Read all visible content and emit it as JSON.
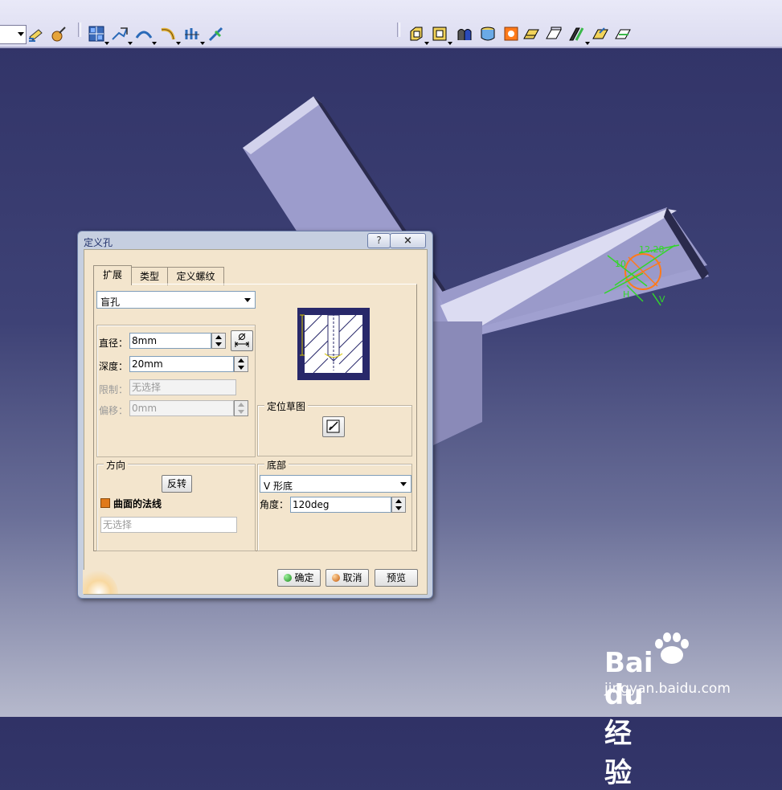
{
  "dialog": {
    "title": "定义孔",
    "help_label": "?",
    "close_label": "×",
    "tabs": [
      {
        "label": "扩展"
      },
      {
        "label": "类型"
      },
      {
        "label": "定义螺纹"
      }
    ],
    "extension_type": "盲孔",
    "diameter": {
      "label": "直径：",
      "value": "8mm"
    },
    "depth": {
      "label": "深度：",
      "value": "20mm"
    },
    "limit": {
      "label": "限制：",
      "placeholder": "无选择"
    },
    "offset": {
      "label": "偏移：",
      "value": "0mm"
    },
    "positioning_sketch": {
      "title": "定位草图"
    },
    "direction": {
      "title": "方向",
      "reverse_label": "反转",
      "surface_normal_label": "曲面的法线",
      "placeholder": "无选择"
    },
    "bottom": {
      "title": "底部",
      "type": "V 形底",
      "angle_label": "角度：",
      "angle_value": "120deg"
    },
    "ok_label": "确定",
    "cancel_label": "取消",
    "preview_label": "预览"
  },
  "viewport": {
    "background_color": "#34366a",
    "part_color": "#9a9ac8",
    "sketch_color": "#32d62a",
    "hole_color": "#ff7a1a",
    "annotations": [
      "10",
      "12.28",
      "H",
      "V"
    ]
  },
  "watermark": {
    "brand_text": "Bai du 经验",
    "url": "jingyan.baidu.com"
  },
  "toolbar": {
    "icons": [
      "sketch-icon",
      "sketch-analysis-icon",
      "pad-icon",
      "pocket-icon",
      "shaft-icon",
      "groove-icon",
      "rib-icon",
      "stiffener-icon",
      "fillet-icon",
      "chamfer-icon",
      "draft-icon",
      "shell-icon",
      "thickness-icon",
      "thread-icon",
      "hole-icon",
      "remove-face-icon",
      "replace-face-icon",
      "split-icon",
      "thick-surface-icon",
      "close-surface-icon",
      "sew-surface-icon"
    ]
  }
}
